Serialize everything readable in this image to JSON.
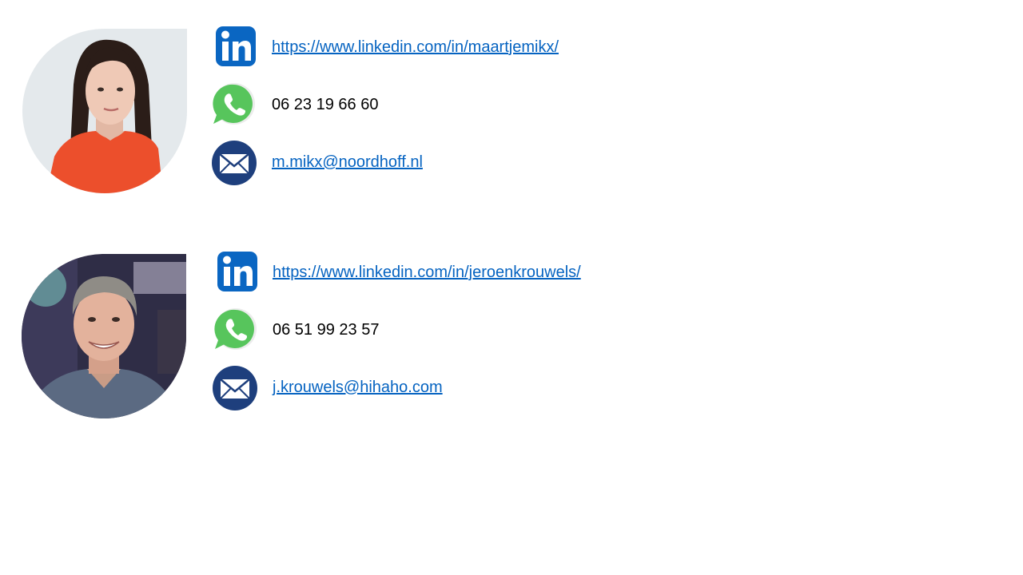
{
  "contacts": [
    {
      "linkedin": "https://www.linkedin.com/in/maartjemikx/",
      "phone": "06 23 19 66 60",
      "email": "m.mikx@noordhoff.nl"
    },
    {
      "linkedin": "https://www.linkedin.com/in/jeroenkrouwels/",
      "phone": "06 51 99 23 57",
      "email": "j.krouwels@hihaho.com"
    }
  ],
  "icons": {
    "linkedin": "linkedin-icon",
    "whatsapp": "whatsapp-icon",
    "email": "email-icon"
  },
  "colors": {
    "link": "#0563c1",
    "linkedin_blue": "#0a66c2",
    "whatsapp_green": "#57c55c",
    "email_navy": "#1e3f7d"
  }
}
